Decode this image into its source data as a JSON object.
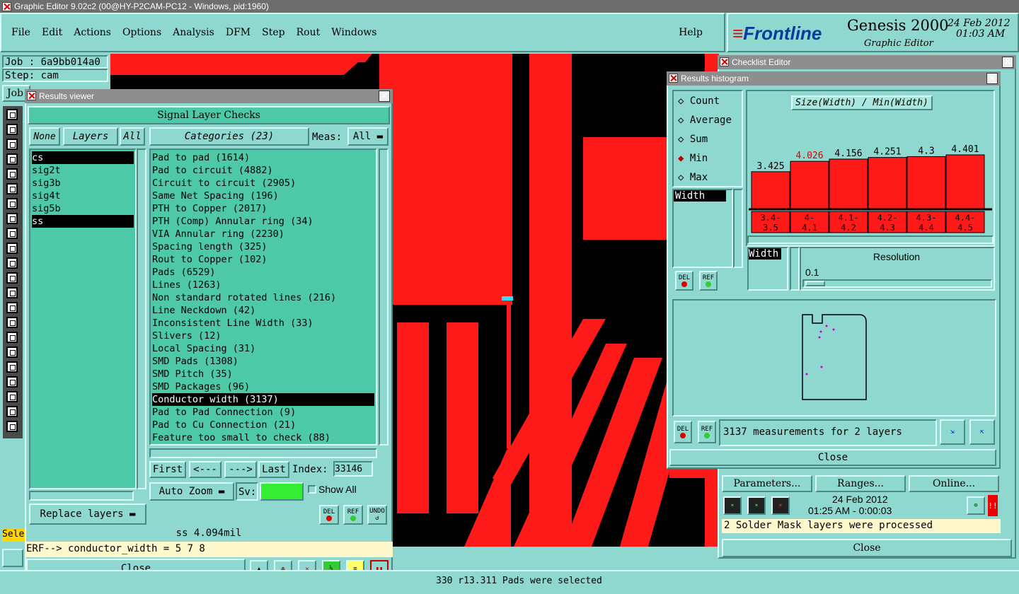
{
  "app": {
    "title": "Graphic Editor 9.02c2 (00@HY-P2CAM-PC12 - Windows, pid:1960)"
  },
  "menu": {
    "items": [
      "File",
      "Edit",
      "Actions",
      "Options",
      "Analysis",
      "DFM",
      "Step",
      "Rout",
      "Windows"
    ],
    "help": "Help"
  },
  "brand": {
    "logo": "Frontline",
    "product": "Genesis 2000",
    "subtitle": "Graphic Editor",
    "date": "24 Feb 2012",
    "time": "01:03 AM"
  },
  "left_panel": {
    "job": "Job : 6a9bb014a0",
    "step": "Step: cam",
    "job_btn": "Job",
    "select_stub": "Sele"
  },
  "results_viewer": {
    "title": "Results viewer",
    "heading": "Signal Layer Checks",
    "none": "None",
    "layers": "Layers",
    "all": "All",
    "categories_btn": "Categories (23)",
    "meas_label": "Meas:",
    "meas_value": "All",
    "layer_list": [
      "cs",
      "sig2t",
      "sig3b",
      "sig4t",
      "sig5b",
      "ss"
    ],
    "categories": [
      "Pad to pad (1614)",
      "Pad to circuit (4882)",
      "Circuit to circuit (2905)",
      "Same Net Spacing (196)",
      "PTH to Copper (2017)",
      "PTH (Comp) Annular ring (34)",
      "VIA Annular ring (2230)",
      "Spacing length (325)",
      "Rout to Copper (102)",
      "Pads (6529)",
      "Lines (1263)",
      "Non standard rotated lines (216)",
      "Line Neckdown (42)",
      "Inconsistent Line Width (33)",
      "Slivers (12)",
      "Local Spacing (31)",
      "SMD Pads (1308)",
      "SMD Pitch (35)",
      "SMD Packages (96)",
      "Conductor width (3137)",
      "Pad to Pad Connection (9)",
      "Pad to Cu Connection (21)",
      "Feature too small to check (88)"
    ],
    "first": "First",
    "prev": "<---",
    "next": "--->",
    "last": "Last",
    "index_label": "Index:",
    "index_value": "33146",
    "auto_zoom": "Auto Zoom",
    "sv": "Sv:",
    "show_all": "Show All",
    "replace_layers": "Replace layers",
    "del": "DEL",
    "ref": "REF",
    "undo": "UNDO",
    "status": "ss 4.094mil",
    "erf": "ERF--> conductor_width = 5 7 8",
    "close": "Close"
  },
  "checklist_editor": {
    "title": "Checklist Editor",
    "parameters": "Parameters...",
    "ranges": "Ranges...",
    "online": "Online...",
    "date": "24 Feb 2012",
    "time": "01:25 AM - 0:00:03",
    "message": "2 Solder Mask layers were processed",
    "close": "Close"
  },
  "histogram": {
    "title": "Results histogram",
    "modes": [
      "Count",
      "Average",
      "Sum",
      "Min",
      "Max"
    ],
    "selected_mode": "Min",
    "chart_title": "Size(Width) / Min(Width)",
    "field": "Width",
    "field2": "Width",
    "resolution_label": "Resolution",
    "resolution_value": "0.1",
    "measurements": "3137 measurements for 2 layers",
    "close": "Close",
    "del": "DEL",
    "ref": "REF"
  },
  "chart_data": {
    "type": "bar",
    "title": "Size(Width) / Min(Width)",
    "categories": [
      "3.4-\n3.5",
      "4-\n4.1",
      "4.1-\n4.2",
      "4.2-\n4.3",
      "4.3-\n4.4",
      "4.4-\n4.5"
    ],
    "values": [
      3.425,
      4.026,
      4.156,
      4.251,
      4.3,
      4.401
    ],
    "value_labels": [
      "3.425",
      "4.026",
      "4.156",
      "4.251",
      "4.3",
      "4.401"
    ],
    "highlight_index": 1,
    "colors": {
      "bar": "#ff1a1a",
      "highlight_label": "#e00000"
    }
  },
  "footer": {
    "status": "330 r13.311 Pads were selected"
  }
}
